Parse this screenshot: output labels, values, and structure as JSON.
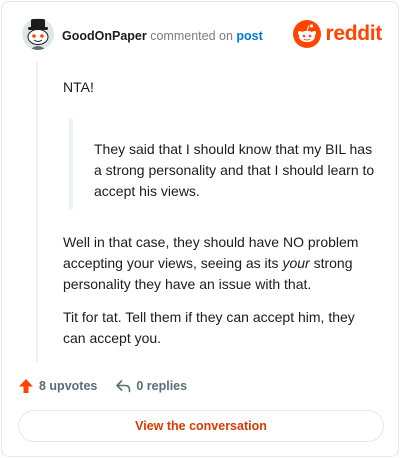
{
  "header": {
    "author": "GoodOnPaper",
    "verb": "commented on",
    "post_link": "post",
    "brand": "reddit"
  },
  "comment": {
    "opening": "NTA!",
    "quote": "They said that I should know that my BIL has a strong personality and that I should learn to accept his views.",
    "paragraph2_before": "Well in that case, they should have NO problem accepting your views, seeing as its ",
    "paragraph2_emphasis": "your",
    "paragraph2_after": " strong personality they have an issue with that.",
    "paragraph3": "Tit for tat. Tell them if they can accept him, they can accept you."
  },
  "stats": {
    "upvotes": "8 upvotes",
    "replies": "0 replies"
  },
  "cta": {
    "label": "View the conversation"
  },
  "colors": {
    "brand_orange": "#ff4500",
    "link_blue": "#0079d3",
    "cta_text": "#d93a00",
    "muted": "#576f76"
  },
  "icons": {
    "avatar": "snoo-avatar-top-hat",
    "brand": "reddit-alien-icon",
    "upvote": "upvote-arrow-icon",
    "reply": "reply-arrow-icon"
  }
}
